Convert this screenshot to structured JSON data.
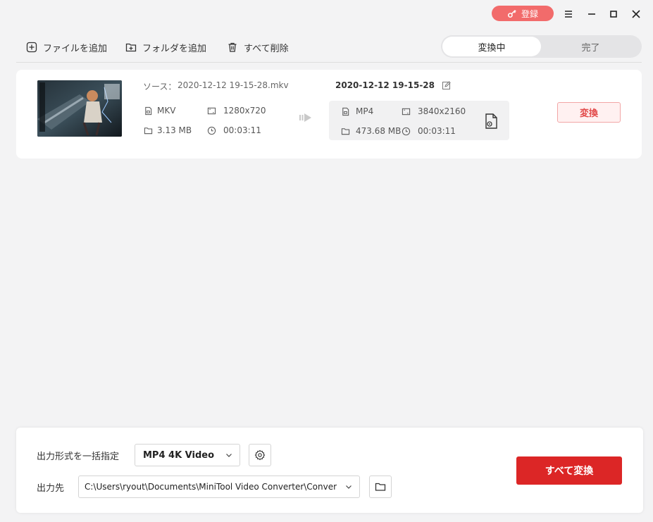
{
  "titlebar": {
    "register_label": "登録"
  },
  "toolbar": {
    "add_file_label": "ファイルを追加",
    "add_folder_label": "フォルダを追加",
    "delete_all_label": "すべて削除"
  },
  "tabs": [
    {
      "label": "変換中",
      "active": true
    },
    {
      "label": "完了",
      "active": false
    }
  ],
  "task": {
    "source_prefix": "ソース：",
    "source_name": "2020-12-12 19-15-28.mkv",
    "source": {
      "format": "MKV",
      "resolution": "1280x720",
      "size": "3.13 MB",
      "duration": "00:03:11"
    },
    "output_name": "2020-12-12 19-15-28",
    "output": {
      "format": "MP4",
      "resolution": "3840x2160",
      "size": "473.68 MB",
      "duration": "00:03:11"
    },
    "convert_label": "変換"
  },
  "bottom": {
    "format_label": "出力形式を一括指定",
    "format_value": "MP4 4K Video",
    "output_label": "出力先",
    "output_path": "C:\\Users\\ryout\\Documents\\MiniTool Video Converter\\Conver",
    "convert_all_label": "すべて変換"
  },
  "colors": {
    "accent": "#dc2626",
    "register": "#f26b6b"
  }
}
